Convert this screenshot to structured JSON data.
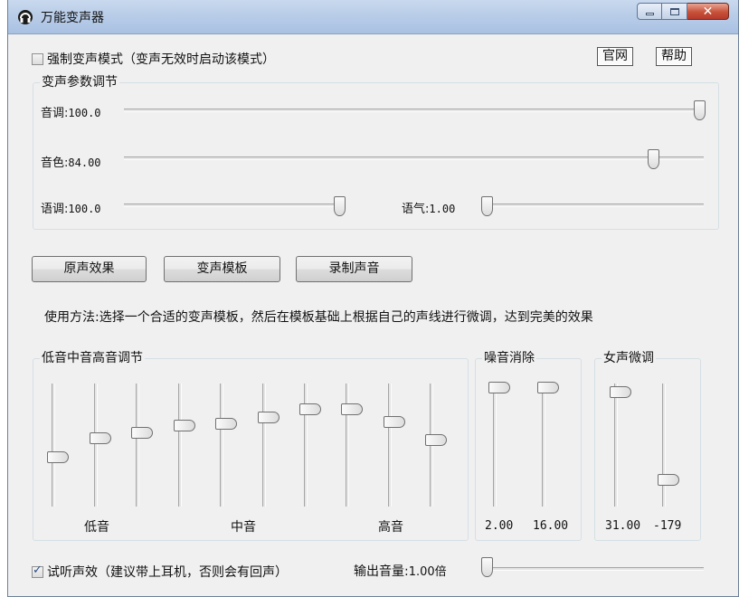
{
  "window": {
    "title": "万能变声器",
    "controls": [
      "minimize-icon",
      "maximize-icon",
      "close-icon"
    ]
  },
  "top": {
    "force_mode_label": "强制变声模式（变声无效时启动该模式）",
    "force_mode_checked": false,
    "official_site_label": "官网",
    "help_label": "帮助"
  },
  "params": {
    "title": "变声参数调节",
    "pitch": {
      "label": "音调:",
      "value": "100.0",
      "level": 1.0
    },
    "timbre": {
      "label": "音色:",
      "value": "84.00",
      "level": 0.92
    },
    "speed": {
      "label": "语调:",
      "value": "100.0",
      "level": 1.0
    },
    "tone": {
      "label": "语气:",
      "value": "1.00",
      "level": 0.0
    }
  },
  "buttons": {
    "original": "原声效果",
    "templates": "变声模板",
    "record": "录制声音"
  },
  "usage_text": "使用方法:选择一个合适的变声模板，然后在模板基础上根据自己的声线进行微调，达到完美的效果",
  "eq": {
    "title": "低音中音高音调节",
    "low_label": "低音",
    "mid_label": "中音",
    "high_label": "高音",
    "levels": [
      0.38,
      0.55,
      0.6,
      0.66,
      0.68,
      0.73,
      0.81,
      0.81,
      0.69,
      0.53
    ]
  },
  "noise": {
    "title": "噪音消除",
    "values": [
      "2.00",
      "16.00"
    ],
    "levels": [
      1.0,
      1.0
    ]
  },
  "female": {
    "title": "女声微调",
    "values": [
      "31.00",
      "-179"
    ],
    "levels": [
      0.96,
      0.18
    ]
  },
  "bottom": {
    "monitor_label": "试听声效（建议带上耳机，否则会有回声）",
    "monitor_checked": true,
    "output_label": "输出音量:",
    "output_value": "1.00倍",
    "output_level": 0.0
  }
}
